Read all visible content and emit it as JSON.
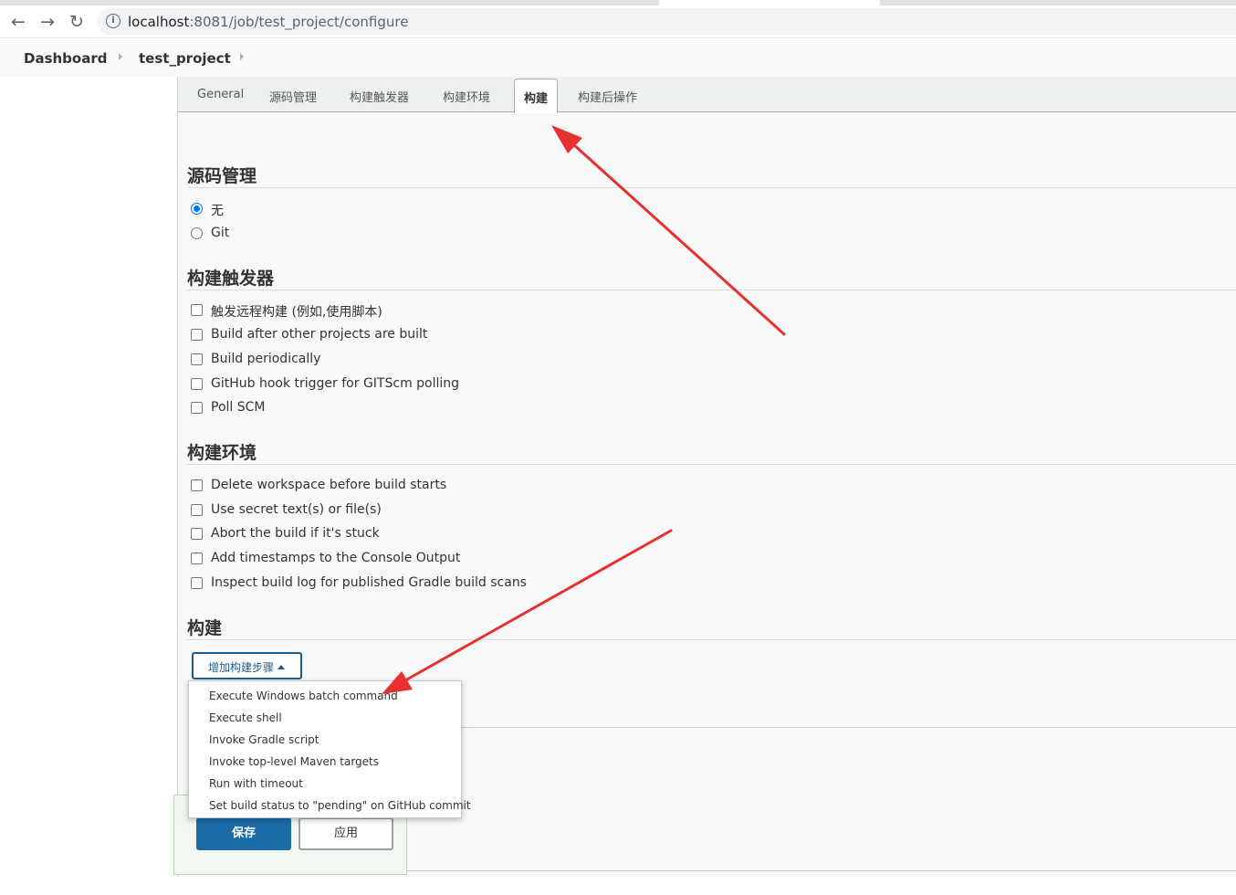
{
  "browser": {
    "nav": {
      "back_icon": "←",
      "forward_icon": "→",
      "reload_icon": "↻"
    },
    "url_host": "localhost",
    "url_rest": ":8081/job/test_project/configure"
  },
  "breadcrumb": {
    "items": [
      "Dashboard",
      "test_project"
    ]
  },
  "tabs": [
    "General",
    "源码管理",
    "构建触发器",
    "构建环境",
    "构建",
    "构建后操作"
  ],
  "active_tab": "构建",
  "scm": {
    "title": "源码管理",
    "options": [
      "无",
      "Git"
    ],
    "selected": "无"
  },
  "triggers": {
    "title": "构建触发器",
    "options": [
      "触发远程构建 (例如,使用脚本)",
      "Build after other projects are built",
      "Build periodically",
      "GitHub hook trigger for GITScm polling",
      "Poll SCM"
    ]
  },
  "environment": {
    "title": "构建环境",
    "options": [
      "Delete workspace before build starts",
      "Use secret text(s) or file(s)",
      "Abort the build if it's stuck",
      "Add timestamps to the Console Output",
      "Inspect build log for published Gradle build scans"
    ]
  },
  "build": {
    "title": "构建",
    "add_step_label": "增加构建步骤",
    "menu_items": [
      "Execute Windows batch command",
      "Execute shell",
      "Invoke Gradle script",
      "Invoke top-level Maven targets",
      "Run with timeout",
      "Set build status to \"pending\" on GitHub commit"
    ]
  },
  "actions": {
    "save_label": "保存",
    "apply_label": "应用"
  },
  "colors": {
    "accent": "#1a6ba6",
    "annotation_arrow": "#e8312f",
    "radio_selected": "#0075ff"
  }
}
